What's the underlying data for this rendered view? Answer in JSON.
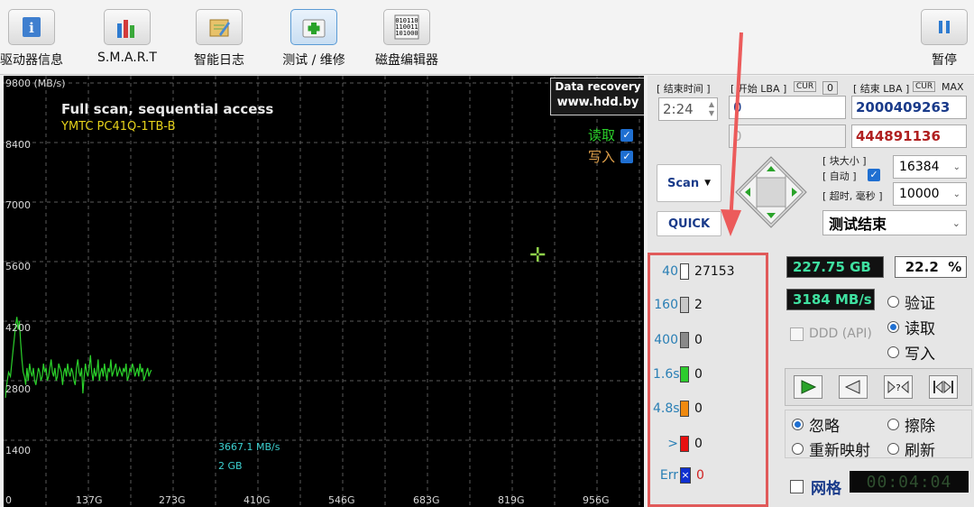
{
  "toolbar": {
    "drive_info": "驱动器信息",
    "smart": "S.M.A.R.T",
    "smart_log": "智能日志",
    "test_repair": "测试 / 维修",
    "disk_editor": "磁盘编辑器",
    "pause": "暂停"
  },
  "graph": {
    "unit": "(MB/s)",
    "y_ticks": [
      "9800",
      "8400",
      "7000",
      "5600",
      "4200",
      "2800",
      "1400"
    ],
    "x_ticks": [
      "0",
      "137G",
      "273G",
      "410G",
      "546G",
      "683G",
      "819G",
      "956G"
    ],
    "title": "Full scan, sequential access",
    "model": "YMTC PC41Q-1TB-B",
    "watermark_line1": "Data recovery",
    "watermark_line2": "www.hdd.by",
    "legend_read": "读取",
    "legend_write": "写入",
    "speed_label": "3667.1 MB/s",
    "size_label": "2 GB",
    "colors": {
      "read": "#2bd12b",
      "write": "#e0a04a",
      "grid": "#5a5a5a"
    }
  },
  "chart_data": {
    "type": "line",
    "xlabel": "",
    "ylabel": "(MB/s)",
    "xlim": [
      0,
      1000
    ],
    "ylim": [
      0,
      9800
    ],
    "series": [
      {
        "name": "读取",
        "x": [
          0,
          2,
          5,
          8,
          10,
          12,
          14,
          16,
          18,
          20,
          22,
          24,
          26,
          28,
          30,
          32,
          34,
          36,
          38,
          40,
          42,
          44,
          46,
          48,
          50,
          52,
          54,
          56,
          58,
          60,
          62,
          64,
          66,
          68,
          70,
          72,
          74,
          76,
          78,
          80,
          82,
          84,
          86,
          88,
          90,
          92,
          94,
          96,
          98,
          100,
          102,
          104,
          106,
          108,
          110,
          112,
          114,
          116,
          118,
          120,
          122,
          124,
          126,
          128,
          130,
          132,
          134,
          136,
          138,
          140,
          142,
          144,
          146,
          148,
          150,
          152,
          154,
          156,
          158,
          160,
          162,
          164,
          166,
          168,
          170,
          172,
          174,
          176,
          178,
          180,
          182,
          184,
          186,
          188,
          190,
          192,
          194,
          196,
          198,
          200,
          202,
          204,
          206,
          208,
          210,
          212,
          214,
          216,
          218,
          220,
          222,
          224,
          226,
          228,
          230
        ],
        "y": [
          2400,
          2700,
          3000,
          2900,
          3200,
          3500,
          3800,
          4100,
          4300,
          4000,
          4200,
          3700,
          3300,
          3000,
          2900,
          2700,
          3100,
          2800,
          3200,
          3000,
          2900,
          3100,
          2800,
          2700,
          2900,
          3100,
          3000,
          2800,
          2900,
          3200,
          3000,
          3100,
          2800,
          2900,
          3100,
          3300,
          3000,
          2900,
          3100,
          2800,
          2900,
          3200,
          3100,
          3000,
          2700,
          3000,
          3100,
          2900,
          3200,
          3000,
          2900,
          3100,
          3000,
          2800,
          2700,
          3100,
          3300,
          3000,
          2900,
          3100,
          2500,
          2900,
          3200,
          3000,
          2900,
          3100,
          3400,
          3000,
          2800,
          3100,
          2900,
          3000,
          3300,
          2800,
          3000,
          3100,
          2900,
          3200,
          3000,
          2800,
          3100,
          3000,
          3300,
          2900,
          3000,
          3100,
          3200,
          2900,
          3000,
          3100,
          3000,
          2900,
          3100,
          3000,
          3200,
          2800,
          2900,
          3100,
          3000,
          3200,
          3100,
          2900,
          3000,
          3100,
          2900,
          3200,
          3000,
          3100,
          2800,
          2900,
          3000,
          3100,
          2900,
          3000,
          3050
        ]
      }
    ]
  },
  "panel": {
    "end_time_label": "[ 结束时间 ]",
    "start_lba_label": "[ 开始 LBA ]",
    "cur_tag": "CUR",
    "cur_val": "0",
    "end_lba_label": "[ 结束 LBA ]",
    "max_tag": "MAX",
    "time_value": "2:24",
    "start_lba": "0",
    "start_lba2": "0",
    "end_lba": "2000409263",
    "cur_lba": "444891136",
    "scan_btn": "Scan",
    "quick_btn": "QUICK",
    "block_size_label": "[ 块大小 ]",
    "auto_label": "[ 自动 ]",
    "timeout_label": "[ 超时, 毫秒 ]",
    "block_size": "16384",
    "timeout": "10000",
    "status": "测试结束",
    "stats": [
      {
        "label": "40",
        "count": "27153",
        "color": "#ffffff"
      },
      {
        "label": "160",
        "count": "2",
        "color": "#c8c8c8"
      },
      {
        "label": "400",
        "count": "0",
        "color": "#8a8a8a"
      },
      {
        "label": "1.6s",
        "count": "0",
        "color": "#2ecc2e"
      },
      {
        "label": "4.8s",
        "count": "0",
        "color": "#f08a10"
      },
      {
        "label": ">",
        "count": "0",
        "color": "#e81010"
      },
      {
        "label": "Err",
        "count": "0",
        "color": "#1030d0"
      }
    ],
    "capacity": "227.75 GB",
    "percent": "22.2",
    "percent_sign": "%",
    "speed": "3184 MB/s",
    "ddd": "DDD (API)",
    "verify": "验证",
    "read": "读取",
    "write": "写入",
    "ignore": "忽略",
    "erase": "擦除",
    "remap": "重新映射",
    "refresh": "刷新",
    "grid": "网格",
    "timer": "00:04:04"
  }
}
